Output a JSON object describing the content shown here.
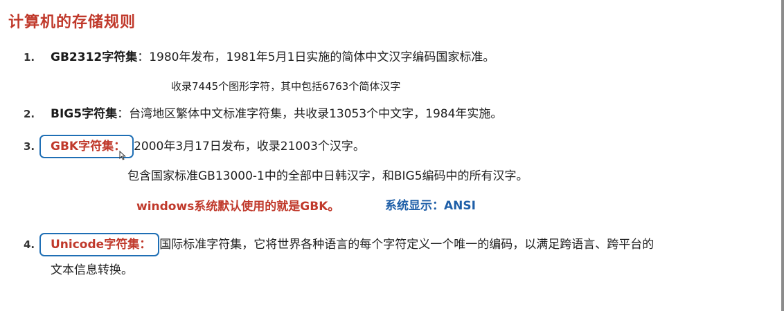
{
  "title": "计算机的存储规则",
  "items": [
    {
      "num": "1.",
      "label": "GB2312字符集",
      "colon": "：",
      "text": "1980年发布，1981年5月1日实施的简体中文汉字编码国家标准。",
      "sub": "收录7445个图形字符，其中包括6763个简体汉字"
    },
    {
      "num": "2.",
      "label": "BIG5字符集",
      "colon": "：",
      "text": "台湾地区繁体中文标准字符集，共收录13053个中文字，1984年实施。"
    },
    {
      "num": "3.",
      "label": "GBK字符集",
      "colon": "：",
      "text": "2000年3月17日发布，收录21003个汉字。",
      "sub": "包含国家标准GB13000-1中的全部中日韩汉字，和BIG5编码中的所有汉字。",
      "note_red": "windows系统默认使用的就是GBK。",
      "note_blue": "系统显示：ANSI"
    },
    {
      "num": "4.",
      "label": "Unicode字符集",
      "colon": "：",
      "text": "国际标准字符集，它将世界各种语言的每个字符定义一个唯一的编码，以满足跨语言、跨平台的",
      "continuation": "文本信息转换。"
    }
  ],
  "colors": {
    "title": "#c0392b",
    "highlight_red": "#c0392b",
    "highlight_blue": "#1f5fa8",
    "box_border": "#1f6fb5"
  }
}
